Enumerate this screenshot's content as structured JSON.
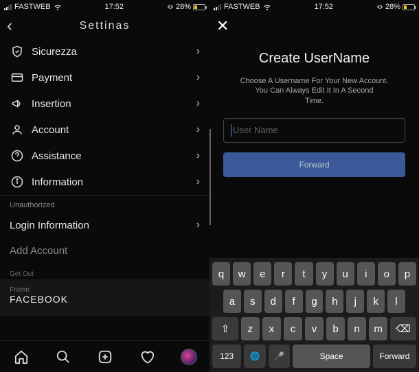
{
  "status": {
    "carrier": "FASTWEB",
    "time": "17:52",
    "battery_pct": "28%"
  },
  "left": {
    "header_title": "Settinas",
    "items": [
      {
        "icon": "shield-icon",
        "label": "Sicurezza"
      },
      {
        "icon": "card-icon",
        "label": "Payment"
      },
      {
        "icon": "megaphone-icon",
        "label": "Insertion"
      },
      {
        "icon": "user-icon",
        "label": "Account"
      },
      {
        "icon": "help-icon",
        "label": "Assistance"
      },
      {
        "icon": "info-icon",
        "label": "Information"
      }
    ],
    "section_unauthorized": "Unauthorized",
    "login_info": "Login Information",
    "add_account": "Add Account",
    "get_out": "Get Out",
    "from_label": "Fromn",
    "facebook": "FACEBOOK"
  },
  "right": {
    "title": "Create UserName",
    "sub1": "Choose A Username For Your New Account.",
    "sub2": "You Can Always Edit It In A Second",
    "sub3": "Time.",
    "placeholder": "User Name",
    "forward_btn": "Forward"
  },
  "keyboard": {
    "row1": [
      "q",
      "w",
      "e",
      "r",
      "t",
      "y",
      "u",
      "i",
      "o",
      "p"
    ],
    "row2": [
      "a",
      "s",
      "d",
      "f",
      "g",
      "h",
      "j",
      "k",
      "l"
    ],
    "row3": [
      "z",
      "x",
      "c",
      "v",
      "b",
      "n",
      "m"
    ],
    "shift": "⇧",
    "backspace": "⌫",
    "num": "123",
    "globe": "🌐",
    "mic": "🎤",
    "space": "Space",
    "forward": "Forward"
  }
}
